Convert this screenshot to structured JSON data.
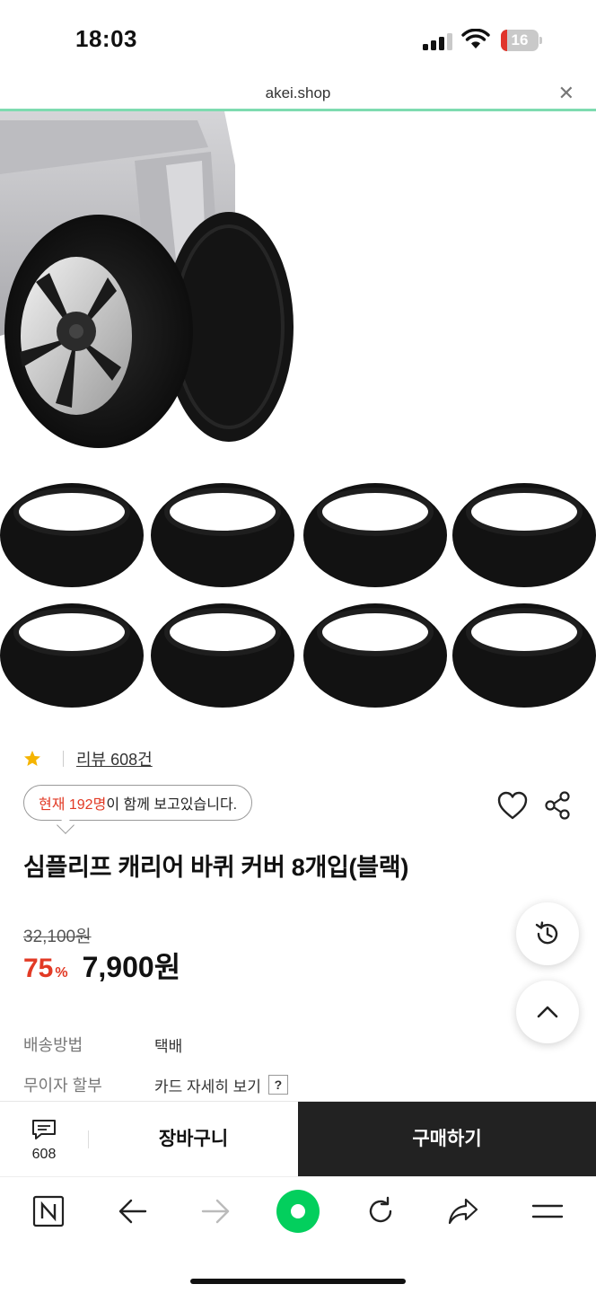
{
  "status_bar": {
    "time": "18:03",
    "battery_level": "16",
    "battery_percent": 16,
    "signal_bars": 3,
    "wifi_icon": "wifi-icon"
  },
  "browser": {
    "url": "akei.shop",
    "close_icon": "close-icon",
    "page_load_progress_percent": 100
  },
  "product": {
    "image_icon": "product-photo-wheel-covers",
    "review_link": "리뷰 608건",
    "viewers": {
      "highlight": "현재 192명",
      "rest": "이 함께 보고있습니다."
    },
    "title": "심플리프 캐리어 바퀴 커버 8개입(블랙)",
    "original_price": "32,100원",
    "discount": "75",
    "discount_unit": "%",
    "sale_price": "7,900원"
  },
  "info": {
    "shipping_label": "배송방법",
    "shipping_value": "택배",
    "installment_label": "무이자 할부",
    "installment_value": "카드 자세히 보기",
    "installment_help": "?"
  },
  "purchase_bar": {
    "review_count": "608",
    "cart_label": "장바구니",
    "buy_label": "구매하기"
  },
  "toolbar_icons": [
    "naver-n-icon",
    "back-arrow-icon",
    "forward-arrow-icon",
    "green-dot-icon",
    "reload-icon",
    "share-arrow-icon",
    "menu-icon"
  ],
  "colors": {
    "accent_red": "#e23a25",
    "star_yellow": "#f5b400",
    "naver_green": "#03cf5d",
    "buy_button_bg": "#222222"
  }
}
